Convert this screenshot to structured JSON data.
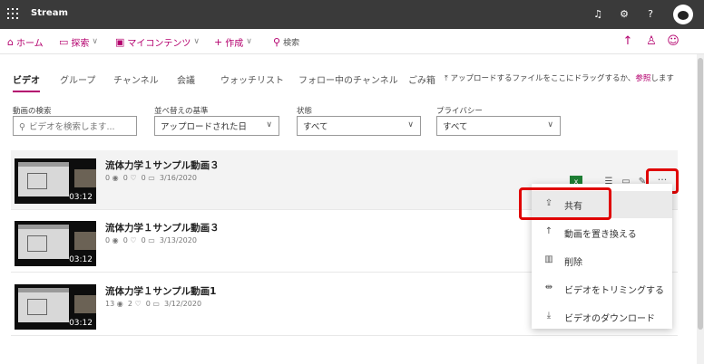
{
  "topbar": {
    "app_title": "Stream",
    "icons": [
      "bell-icon",
      "settings-icon",
      "help-icon",
      "avatar"
    ],
    "help_glyph": "?"
  },
  "nav": {
    "home": "ホーム",
    "explore": "探索",
    "my_content": "マイコンテンツ",
    "create": "作成",
    "search": "検索"
  },
  "tabs": [
    "ビデオ",
    "グループ",
    "チャンネル",
    "会議",
    "ウォッチリスト",
    "フォロー中のチャンネル",
    "ごみ箱"
  ],
  "upload_hint": {
    "text": "アップロードするファイルをここにドラッグするか、",
    "link": "参照",
    "suffix": "します"
  },
  "filters": {
    "search_label": "動画の検索",
    "search_placeholder": "ビデオを検索します...",
    "sort_label": "並べ替えの基準",
    "sort_value": "アップロードされた日",
    "status_label": "状態",
    "status_value": "すべて",
    "privacy_label": "プライバシー",
    "privacy_value": "すべて"
  },
  "videos": [
    {
      "title": "流体力学１サンプル動画３",
      "views": "0",
      "likes": "0",
      "comments": "0",
      "date": "3/16/2020",
      "duration": "03:12"
    },
    {
      "title": "流体力学１サンプル動画３",
      "views": "0",
      "likes": "0",
      "comments": "0",
      "date": "3/13/2020",
      "duration": "03:12"
    },
    {
      "title": "流体力学１サンプル動画1",
      "views": "13",
      "likes": "2",
      "comments": "0",
      "date": "3/12/2020",
      "duration": "03:12"
    }
  ],
  "row_actions": {
    "more": "···"
  },
  "context_menu": {
    "share": "共有",
    "replace": "動画を置き換える",
    "delete": "削除",
    "trim": "ビデオをトリミングする",
    "download": "ビデオのダウンロード"
  },
  "colors": {
    "accent": "#b4006e",
    "topbar": "#3a3a3a",
    "highlight": "#e00000"
  }
}
